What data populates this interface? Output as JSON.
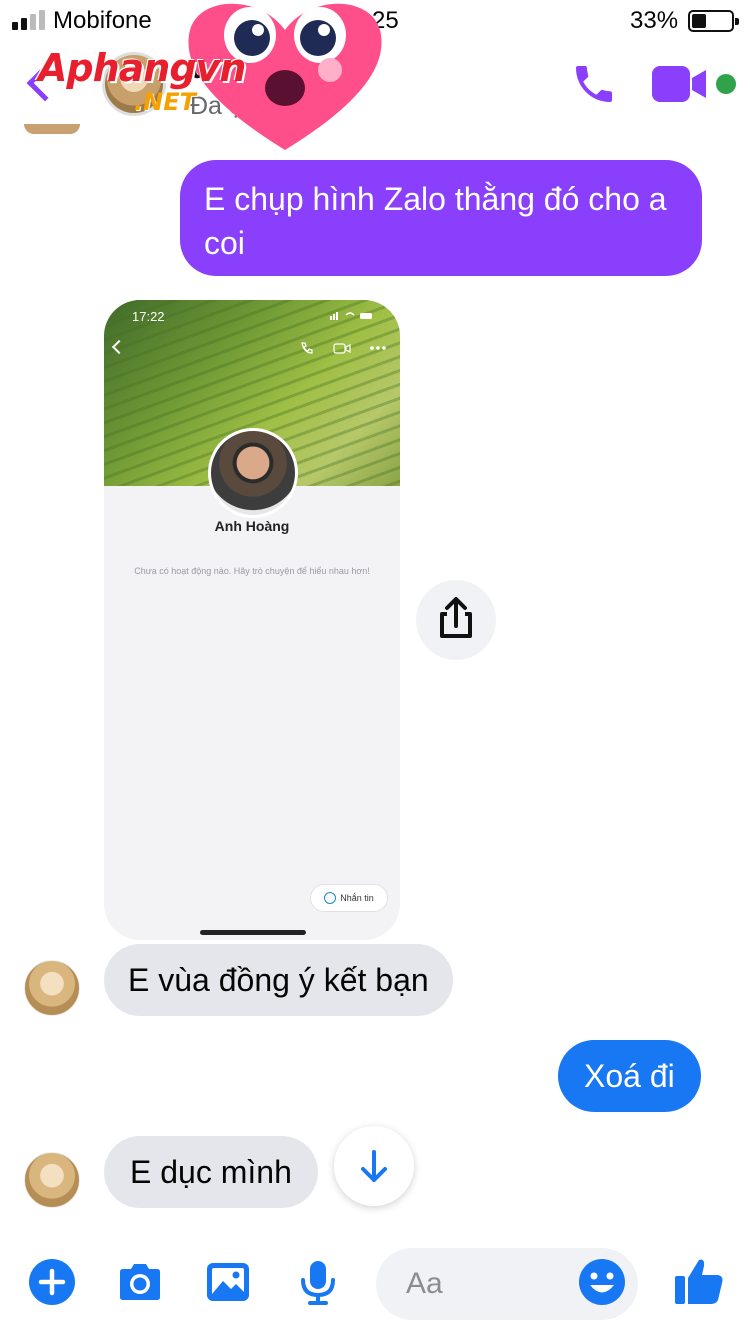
{
  "status_bar": {
    "carrier": "Mobifone",
    "time": "25",
    "battery": "33%"
  },
  "header": {
    "name": "uyen",
    "status": "Đa          ộng"
  },
  "watermark": {
    "brand": "Aphangvn",
    "suffix": ".NET"
  },
  "messages": [
    {
      "direction": "out",
      "text": "E chụp hình Zalo thằng đó cho a coi"
    },
    {
      "direction": "in",
      "text": "E vùa đồng ý kết bạn"
    },
    {
      "direction": "out",
      "text": "Xoá đi"
    },
    {
      "direction": "in",
      "text": "E dục mình"
    }
  ],
  "shared_screenshot": {
    "time": "17:22",
    "profile_name": "Anh Hoàng",
    "note": "Chưa có hoạt động nào. Hãy trò chuyện để hiểu nhau hơn!",
    "button_label": "Nhắn tin"
  },
  "composer": {
    "placeholder": "Aa"
  },
  "colors": {
    "accent_purple": "#8a3ffc",
    "accent_blue": "#1877f2",
    "incoming_bubble": "#e4e6eb",
    "active_green": "#31a24c"
  },
  "icons": [
    "back-icon",
    "call-icon",
    "video-icon",
    "share-icon",
    "scroll-down-icon",
    "plus-icon",
    "camera-icon",
    "gallery-icon",
    "mic-icon",
    "emoji-icon",
    "like-icon"
  ]
}
